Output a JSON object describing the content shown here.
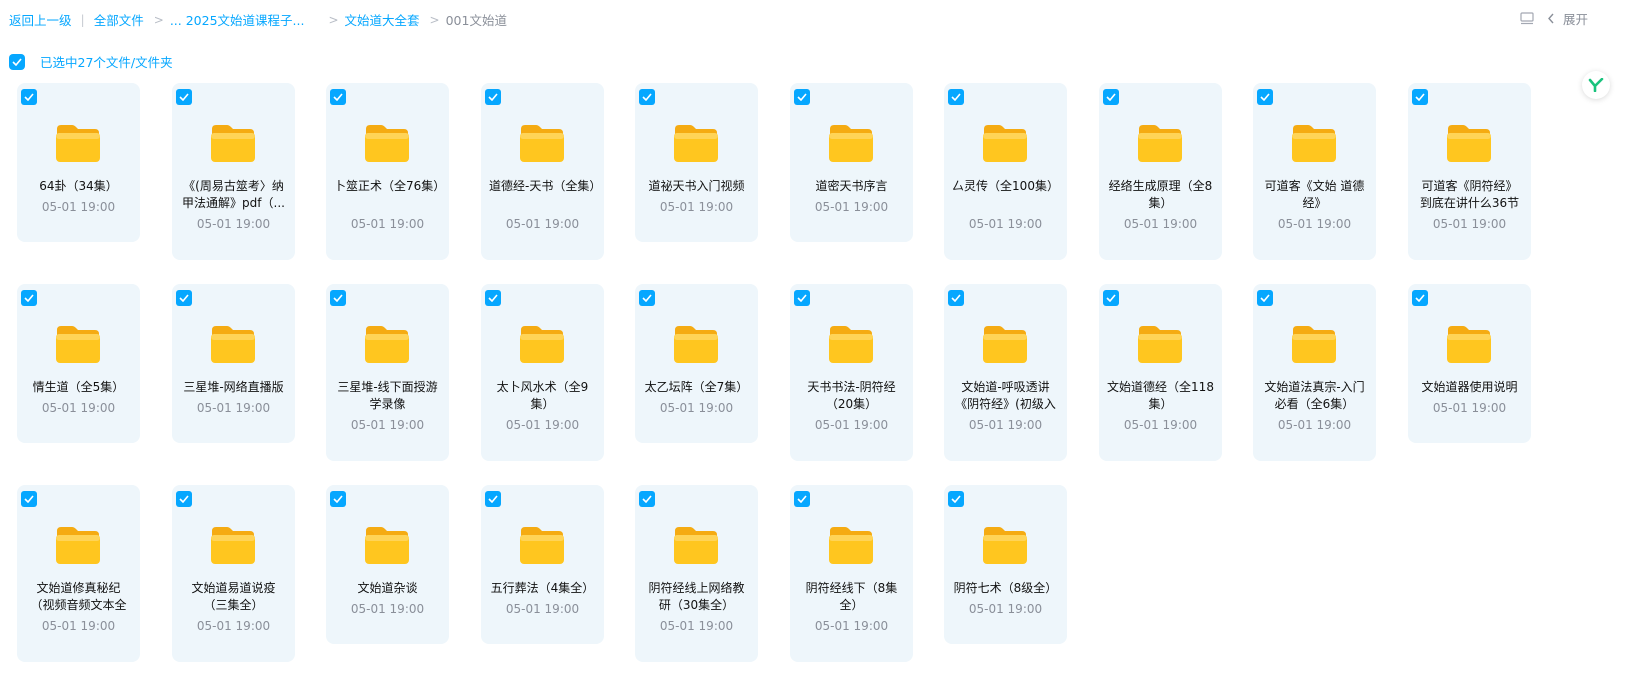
{
  "breadcrumb": {
    "back": "返回上一级",
    "all_files": "全部文件",
    "items": [
      "... 2025文始道课程子...",
      "文始道大全套"
    ],
    "current": "001文始道"
  },
  "toolbar": {
    "expand_label": "展开"
  },
  "selection": {
    "text": "已选中27个文件/文件夹",
    "all_checked": true
  },
  "badge": {
    "letter": "Y"
  },
  "colors": {
    "accent": "#06a7ff",
    "card_bg": "#eef6fb",
    "folder": "#ffc61f"
  },
  "files": [
    {
      "name": "64卦（34集）",
      "time": "05-01 19:00",
      "checked": true
    },
    {
      "name": "《(周易古筮考〉纳甲法通解》pdf（...",
      "time": "05-01 19:00",
      "checked": true
    },
    {
      "name": "卜筮正术（全76集）",
      "time": "05-01 19:00",
      "checked": true
    },
    {
      "name": "道德经-天书（全集）",
      "time": "05-01 19:00",
      "checked": true
    },
    {
      "name": "道祕天书入门视频",
      "time": "05-01 19:00",
      "checked": true
    },
    {
      "name": "道密天书序言",
      "time": "05-01 19:00",
      "checked": true
    },
    {
      "name": "厶灵传（全100集）",
      "time": "05-01 19:00",
      "checked": true
    },
    {
      "name": "经络生成原理（全8集）",
      "time": "05-01 19:00",
      "checked": true
    },
    {
      "name": "可道客《文始 道德经》",
      "time": "05-01 19:00",
      "checked": true
    },
    {
      "name": "可道客《阴符经》到底在讲什么36节",
      "time": "05-01 19:00",
      "checked": true
    },
    {
      "name": "情生道（全5集）",
      "time": "05-01 19:00",
      "checked": true
    },
    {
      "name": "三星堆-网络直播版",
      "time": "05-01 19:00",
      "checked": true
    },
    {
      "name": "三星堆-线下面授游学录像",
      "time": "05-01 19:00",
      "checked": true
    },
    {
      "name": "太卜风水术（全9集）",
      "time": "05-01 19:00",
      "checked": true
    },
    {
      "name": "太乙坛阵（全7集）",
      "time": "05-01 19:00",
      "checked": true
    },
    {
      "name": "天书书法-阴符经（20集）",
      "time": "05-01 19:00",
      "checked": true
    },
    {
      "name": "文始道-呼吸透讲《阴符经》(初级入",
      "time": "05-01 19:00",
      "checked": true
    },
    {
      "name": "文始道德经（全118集）",
      "time": "05-01 19:00",
      "checked": true
    },
    {
      "name": "文始道法真宗-入门必看（全6集）",
      "time": "05-01 19:00",
      "checked": true
    },
    {
      "name": "文始道器使用说明",
      "time": "05-01 19:00",
      "checked": true
    },
    {
      "name": "文始道修真秘纪（视频音频文本全",
      "time": "05-01 19:00",
      "checked": true
    },
    {
      "name": "文始道易道说疫（三集全）",
      "time": "05-01 19:00",
      "checked": true
    },
    {
      "name": "文始道杂谈",
      "time": "05-01 19:00",
      "checked": true
    },
    {
      "name": "五行葬法（4集全）",
      "time": "05-01 19:00",
      "checked": true
    },
    {
      "name": "阴符经线上网络教研（30集全）",
      "time": "05-01 19:00",
      "checked": true
    },
    {
      "name": "阴符经线下（8集全）",
      "time": "05-01 19:00",
      "checked": true
    },
    {
      "name": "阴符七术（8级全）",
      "time": "05-01 19:00",
      "checked": true
    }
  ]
}
